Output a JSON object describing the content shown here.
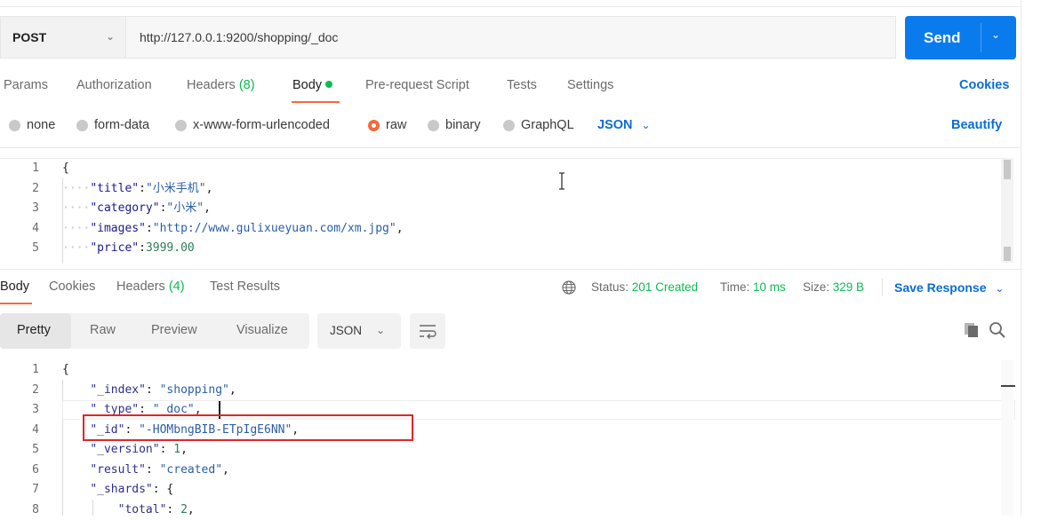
{
  "request": {
    "method": "POST",
    "url": "http://127.0.0.1:9200/shopping/_doc",
    "send_label": "Send"
  },
  "request_tabs": {
    "params": "Params",
    "authorization": "Authorization",
    "headers": "Headers",
    "headers_count": "(8)",
    "body": "Body",
    "prerequest": "Pre-request Script",
    "tests": "Tests",
    "settings": "Settings",
    "cookies": "Cookies"
  },
  "body_types": {
    "none": "none",
    "form_data": "form-data",
    "urlencoded": "x-www-form-urlencoded",
    "raw": "raw",
    "binary": "binary",
    "graphql": "GraphQL",
    "format": "JSON",
    "beautify": "Beautify"
  },
  "request_body": {
    "lines": [
      {
        "no": "1",
        "text": "{"
      },
      {
        "no": "2",
        "key": "\"title\"",
        "value": "\"小米手机\"",
        "tail": ","
      },
      {
        "no": "3",
        "key": "\"category\"",
        "value": "\"小米\"",
        "tail": ","
      },
      {
        "no": "4",
        "key": "\"images\"",
        "value": "\"http://www.gulixueyuan.com/xm.jpg\"",
        "tail": ","
      },
      {
        "no": "5",
        "key": "\"price\"",
        "value": "3999.00",
        "tail": ""
      }
    ]
  },
  "response_tabs": {
    "body": "Body",
    "cookies": "Cookies",
    "headers": "Headers",
    "headers_count": "(4)",
    "test_results": "Test Results"
  },
  "response_status": {
    "status_label": "Status:",
    "status_value": "201 Created",
    "time_label": "Time:",
    "time_value": "10 ms",
    "size_label": "Size:",
    "size_value": "329 B",
    "save_response": "Save Response"
  },
  "response_view": {
    "pretty": "Pretty",
    "raw": "Raw",
    "preview": "Preview",
    "visualize": "Visualize",
    "format": "JSON"
  },
  "response_body": {
    "lines": [
      {
        "no": "1",
        "text": "{"
      },
      {
        "no": "2",
        "key": "\"_index\"",
        "value": "\"shopping\"",
        "tail": ","
      },
      {
        "no": "3",
        "key": "\"_type\"",
        "value": "\"_doc\"",
        "tail": ","
      },
      {
        "no": "4",
        "key": "\"_id\"",
        "value": "\"-HOMbngBIB-ETpIgE6NN\"",
        "tail": ","
      },
      {
        "no": "5",
        "key": "\"_version\"",
        "value": "1",
        "tail": ","
      },
      {
        "no": "6",
        "key": "\"result\"",
        "value": "\"created\"",
        "tail": ","
      },
      {
        "no": "7",
        "key": "\"_shards\"",
        "value": "{",
        "tail": ""
      },
      {
        "no": "8",
        "key": "\"total\"",
        "value": "2",
        "tail": ","
      }
    ]
  },
  "colors": {
    "accent": "#f26b3a",
    "send": "#097bed",
    "success": "#0cbb52",
    "highlight": "#e0262b"
  }
}
